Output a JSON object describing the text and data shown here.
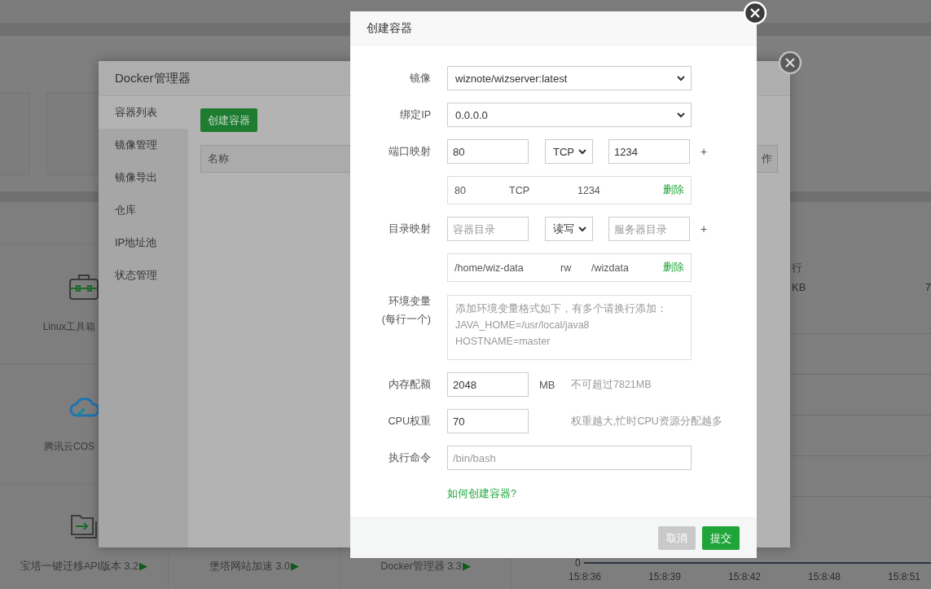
{
  "background": {
    "plugin_tiles": [
      {
        "label": "Linux工具箱"
      },
      {
        "label": "腾讯云COS"
      },
      {
        "label": "宝塔一键迁移API版本 3.2",
        "arrow": "▶"
      },
      {
        "label": "堡塔网站加速 3.0",
        "arrow": "▶"
      },
      {
        "label": "Docker管理器 3.3",
        "arrow": "▶"
      }
    ],
    "stats": {
      "header": "行",
      "value": "KB",
      "value_2": "7"
    },
    "chart_axis": {
      "y_tick": "0",
      "x_ticks": [
        "15:8:36",
        "15:8:39",
        "15:8:42",
        "15:8:48",
        "15:8:51"
      ]
    }
  },
  "docker_manager": {
    "title": "Docker管理器",
    "sidebar": [
      {
        "label": "容器列表",
        "selected": true
      },
      {
        "label": "镜像管理",
        "selected": false
      },
      {
        "label": "镜像导出",
        "selected": false
      },
      {
        "label": "仓库",
        "selected": false
      },
      {
        "label": "IP地址池",
        "selected": false
      },
      {
        "label": "状态管理",
        "selected": false
      }
    ],
    "create_button": "创建容器",
    "table": {
      "columns": [
        "名称",
        "作"
      ]
    }
  },
  "create_container": {
    "title": "创建容器",
    "image": {
      "label": "镜像",
      "value": "wiznote/wizserver:latest"
    },
    "bind_ip": {
      "label": "绑定IP",
      "value": "0.0.0.0"
    },
    "port_mapping": {
      "label": "端口映射",
      "container_port": "80",
      "protocol": "TCP",
      "host_port": "1234",
      "add": "+",
      "entries": [
        {
          "container_port": "80",
          "protocol": "TCP",
          "host_port": "1234",
          "delete": "删除"
        }
      ]
    },
    "dir_mapping": {
      "label": "目录映射",
      "container_dir_placeholder": "容器目录",
      "mode": "读写",
      "host_dir_placeholder": "服务器目录",
      "add": "+",
      "entries": [
        {
          "path_1": "/home/wiz-data",
          "mode": "rw",
          "path_2": "/wizdata",
          "delete": "删除"
        }
      ]
    },
    "env": {
      "label": "环境变量",
      "label_note": "(每行一个)",
      "placeholder": [
        "添加环境变量格式如下，有多个请换行添加：",
        "JAVA_HOME=/usr/local/java8",
        "HOSTNAME=master"
      ]
    },
    "memory": {
      "label": "内存配额",
      "value": "2048",
      "unit": "MB",
      "hint": "不可超过7821MB"
    },
    "cpu": {
      "label": "CPU权重",
      "value": "70",
      "hint": "权重越大,忙时CPU资源分配越多"
    },
    "command": {
      "label": "执行命令",
      "placeholder": "/bin/bash"
    },
    "help_link": "如何创建容器?",
    "buttons": [
      {
        "label": "取消",
        "kind": "secondary"
      },
      {
        "label": "提交",
        "kind": "primary"
      }
    ]
  }
}
